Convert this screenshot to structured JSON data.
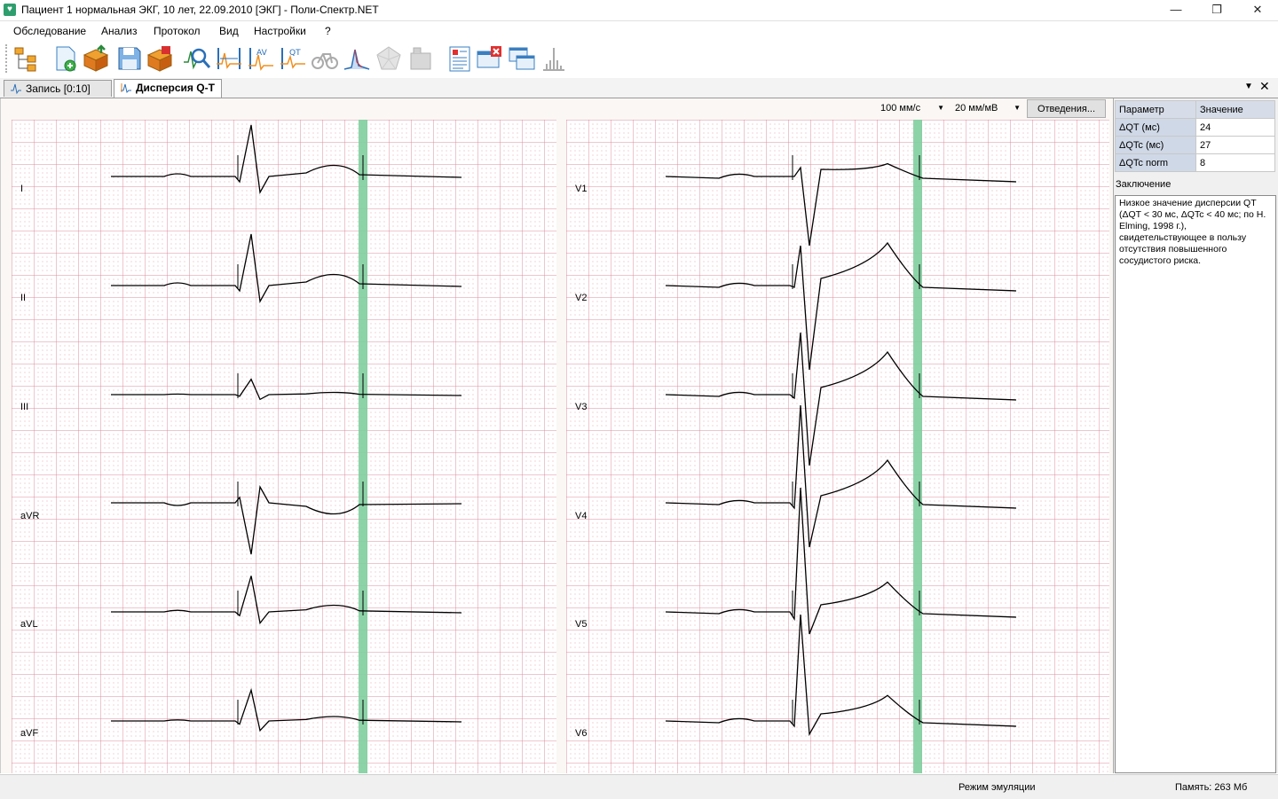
{
  "window": {
    "title": "Пациент 1 нормальная ЭКГ, 10 лет, 22.09.2010 [ЭКГ] - Поли-Спектр.NET",
    "controls": {
      "minimize": "—",
      "maximize": "❐",
      "close": "✕"
    }
  },
  "menu": [
    "Обследование",
    "Анализ",
    "Протокол",
    "Вид",
    "Настройки",
    "?"
  ],
  "toolbar": {
    "buttons": [
      "tree-view-icon",
      "new-exam-icon",
      "open-exam-icon",
      "save-exam-icon",
      "export-icon",
      "search-complex-icon",
      "interval-icon",
      "av-interval-icon",
      "qt-interval-icon",
      "bicycle-icon",
      "spectrum-icon",
      "vector-icon",
      "building-icon",
      "protocol-icon",
      "close-window-icon",
      "windows-icon",
      "histogram-icon"
    ]
  },
  "tabs": [
    {
      "label": "Запись [0:10]",
      "active": false
    },
    {
      "label": "Дисперсия Q-T",
      "active": true
    }
  ],
  "controls": {
    "speed": "100 мм/с",
    "gain": "20 мм/мВ",
    "leads_button": "Отведения..."
  },
  "leads_left": [
    "I",
    "II",
    "III",
    "aVR",
    "aVL",
    "aVF"
  ],
  "leads_right": [
    "V1",
    "V2",
    "V3",
    "V4",
    "V5",
    "V6"
  ],
  "colors": {
    "grid_minor": "#e7a8b8",
    "grid_major": "#dc8da2",
    "marker": "#7fcf9e",
    "trace": "#000000"
  },
  "table": {
    "headers": [
      "Параметр",
      "Значение"
    ],
    "rows": [
      {
        "name": "ΔQT (мс)",
        "value": "24"
      },
      {
        "name": "ΔQTc (мс)",
        "value": "27"
      },
      {
        "name": "ΔQTc norm",
        "value": "8"
      }
    ]
  },
  "conclusion": {
    "label": "Заключение",
    "text": "Низкое значение дисперсии QT (ΔQT < 30 мс, ΔQTc < 40 мс; по H. Elming, 1998 г.), свидетельствующее в пользу отсутствия повышенного сосудистого риска."
  },
  "status": {
    "mode": "Режим эмуляции",
    "memory": "Память: 263 Мб"
  }
}
